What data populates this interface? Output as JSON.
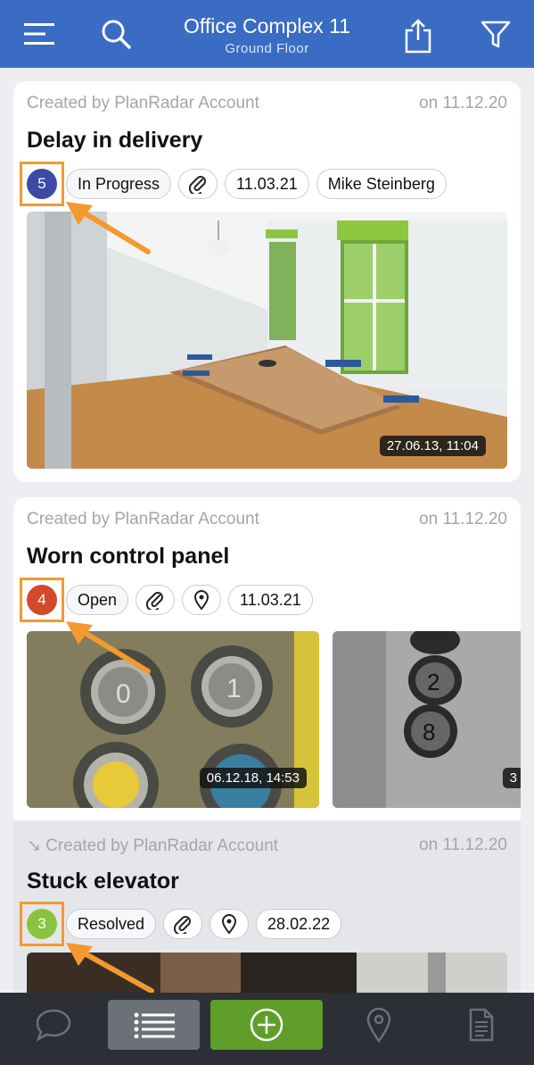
{
  "header": {
    "title": "Office Complex 11",
    "subtitle": "Ground Floor",
    "icons": [
      "menu-icon",
      "search-icon",
      "share-icon",
      "filter-icon"
    ]
  },
  "tickets": [
    {
      "created_by": "Created by PlanRadar Account",
      "created_on": "on 11.12.20",
      "title": "Delay in delivery",
      "number": "5",
      "number_color": "#3c4aa6",
      "status": "In Progress",
      "due_date": "11.03.21",
      "assignee": "Mike Steinberg",
      "photo_timestamp": "27.06.13, 11:04"
    },
    {
      "created_by": "Created by PlanRadar Account",
      "created_on": "on 11.12.20",
      "title": "Worn control panel",
      "number": "4",
      "number_color": "#d24a2a",
      "status": "Open",
      "due_date": "11.03.21",
      "photo_timestamp": "06.12.18, 14:53",
      "photo2_timestamp": "3"
    },
    {
      "created_by": "↘ Created by PlanRadar Account",
      "created_on": "on 11.12.20",
      "title": "Stuck elevator",
      "number": "3",
      "number_color": "#8ac43f",
      "status": "Resolved",
      "due_date": "28.02.22"
    }
  ],
  "colors": {
    "header": "#3a6cc4",
    "highlight": "#f39a2e",
    "bottom_bar": "#2c2f35",
    "add_button": "#5f9e2a"
  },
  "bottom_nav": [
    "chat-icon",
    "list-icon",
    "add-icon",
    "location-icon",
    "document-icon"
  ]
}
